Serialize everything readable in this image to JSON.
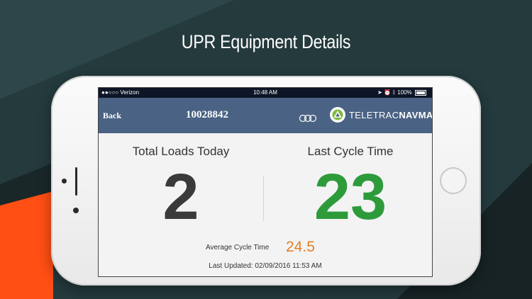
{
  "headline": "UPR Equipment Details",
  "status_bar": {
    "carrier": "●●○○○ Verizon",
    "time": "10:48 AM",
    "battery": "100%"
  },
  "nav": {
    "back_label": "Back",
    "equipment_id": "10028842",
    "logo_text_1": "TELETRAC",
    "logo_text_2": "NAVMAN"
  },
  "stats": {
    "total_loads_label": "Total Loads Today",
    "total_loads_value": "2",
    "last_cycle_label": "Last Cycle Time",
    "last_cycle_value": "23",
    "average_cycle_label": "Average Cycle Time",
    "average_cycle_value": "24.5",
    "last_updated": "Last Updated: 02/09/2016 11:53 AM"
  },
  "colors": {
    "accent_green": "#2e9b3b",
    "accent_orange": "#e57f24",
    "nav_blue": "#4a6283"
  }
}
